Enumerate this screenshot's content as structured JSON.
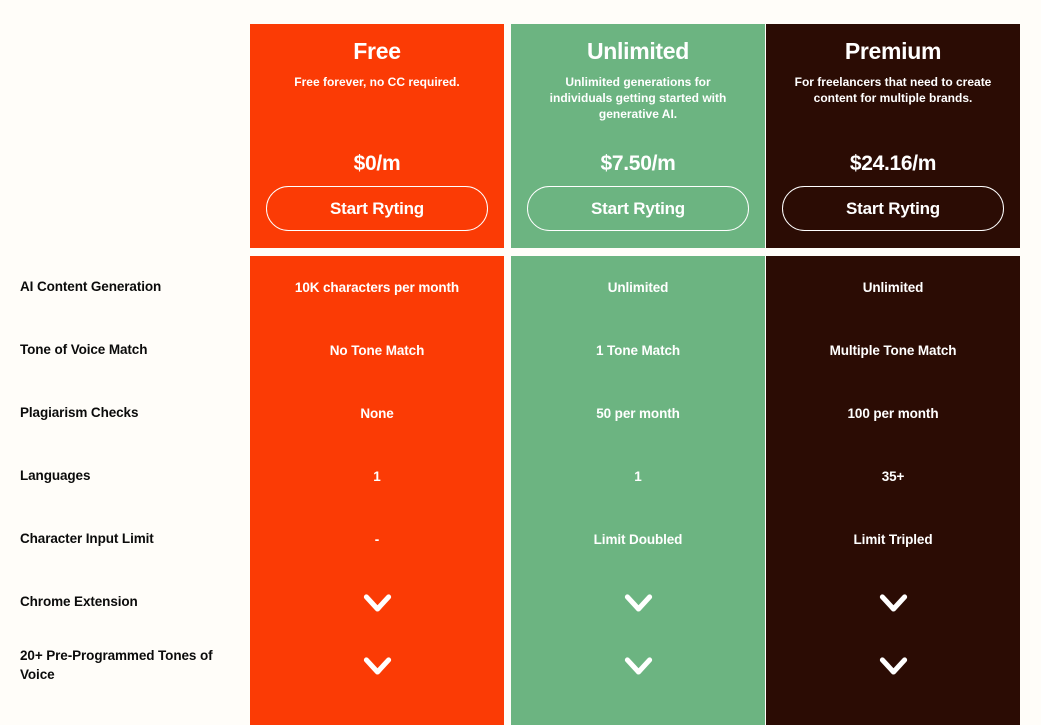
{
  "page": {
    "background_color": "#FFFDF9",
    "text_color": "#0B0B0B"
  },
  "plans": [
    {
      "id": "free",
      "name": "Free",
      "description": "Free forever, no CC required.",
      "price": "$0/m",
      "cta_label": "Start Ryting",
      "color": "#FB3B05"
    },
    {
      "id": "unlimited",
      "name": "Unlimited",
      "description": "Unlimited generations for individuals getting started with generative AI.",
      "price": "$7.50/m",
      "cta_label": "Start Ryting",
      "color": "#6CB481"
    },
    {
      "id": "premium",
      "name": "Premium",
      "description": "For freelancers that need to create content for multiple brands.",
      "price": "$24.16/m",
      "cta_label": "Start Ryting",
      "color": "#2B0C04"
    }
  ],
  "features": [
    {
      "label": "AI Content Generation",
      "values": [
        "10K characters per month",
        "Unlimited",
        "Unlimited"
      ]
    },
    {
      "label": "Tone of Voice Match",
      "values": [
        "No Tone Match",
        "1 Tone Match",
        "Multiple Tone Match"
      ]
    },
    {
      "label": "Plagiarism Checks",
      "values": [
        "None",
        "50 per month",
        "100 per month"
      ]
    },
    {
      "label": "Languages",
      "values": [
        "1",
        "1",
        "35+"
      ]
    },
    {
      "label": "Character Input Limit",
      "values": [
        "-",
        "Limit Doubled",
        "Limit Tripled"
      ]
    },
    {
      "label": "Chrome Extension",
      "values": [
        "check",
        "check",
        "check"
      ]
    },
    {
      "label": "20+ Pre-Programmed Tones of Voice",
      "values": [
        "check",
        "check",
        "check"
      ]
    }
  ]
}
